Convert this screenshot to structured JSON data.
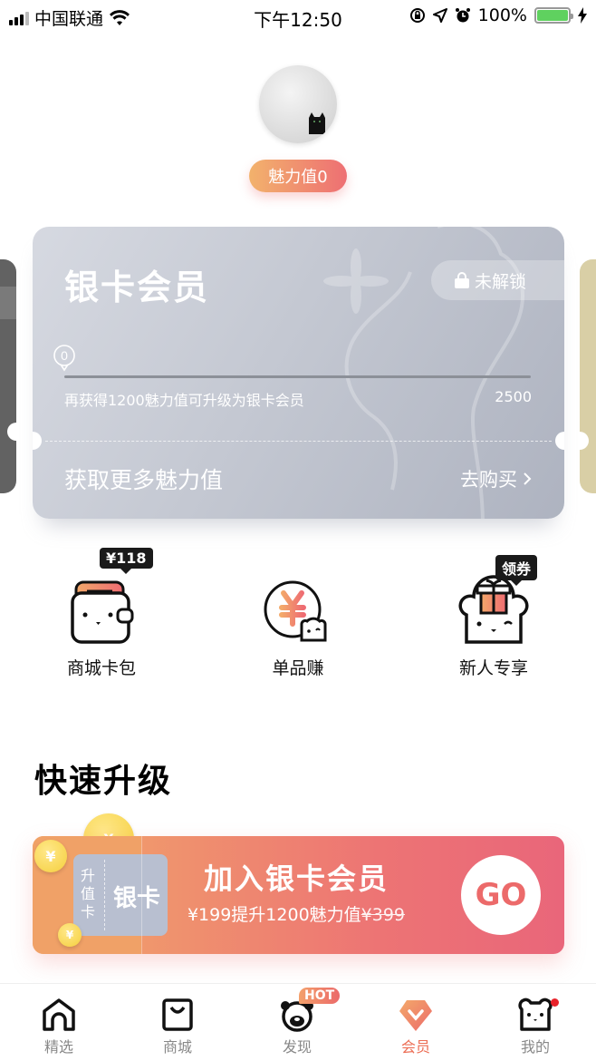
{
  "status_bar": {
    "carrier": "中国联通",
    "time": "下午12:50",
    "battery": "100%"
  },
  "profile": {
    "charm_badge": "魅力值0"
  },
  "member_card": {
    "title": "银卡会员",
    "lock_status": "未解锁",
    "progress_current": "0",
    "progress_max": "2500",
    "progress_fraction": 0,
    "hint": "再获得1200魅力值可升级为银卡会员",
    "more_charm": "获取更多魅力值",
    "buy_link": "去购买",
    "colors": {
      "silver": "#c4c8d2",
      "left_card": "#626262",
      "right_card": "#d9cfa6"
    }
  },
  "shortcuts": [
    {
      "label": "商城卡包",
      "tip": "¥118"
    },
    {
      "label": "单品赚",
      "tip": ""
    },
    {
      "label": "新人专享",
      "tip": "领券"
    }
  ],
  "quick_upgrade": {
    "section_title": "快速升级",
    "ticket_small": "升值卡",
    "ticket_big": "银卡",
    "promo_title": "加入银卡会员",
    "promo_price": "¥199提升1200魅力值",
    "promo_original": "¥399",
    "go_label": "GO"
  },
  "tab_bar": {
    "items": [
      {
        "label": "精选",
        "icon": "home-icon"
      },
      {
        "label": "商城",
        "icon": "shopping-bag-icon"
      },
      {
        "label": "发现",
        "icon": "bear-face-icon",
        "badge": "HOT"
      },
      {
        "label": "会员",
        "icon": "member-diamond-icon",
        "active": true
      },
      {
        "label": "我的",
        "icon": "profile-bear-icon",
        "dot": true
      }
    ],
    "accent": "#ec6d54"
  }
}
